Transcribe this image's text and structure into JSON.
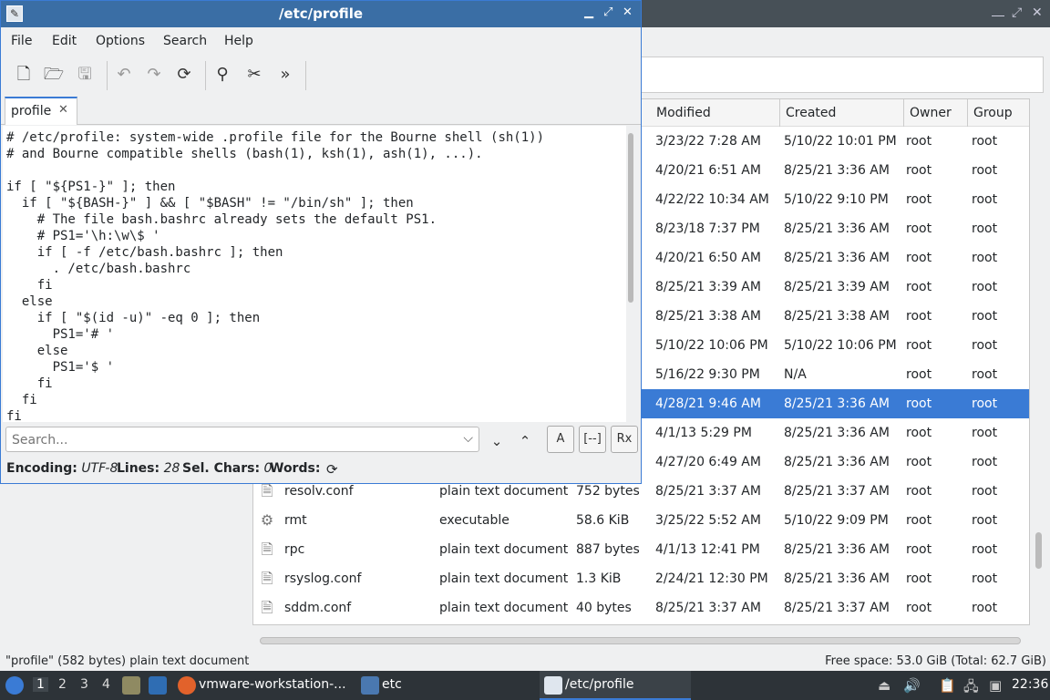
{
  "editor": {
    "title": "/etc/profile",
    "menu": [
      "File",
      "Edit",
      "Options",
      "Search",
      "Help"
    ],
    "tab_label": "profile",
    "code": "# /etc/profile: system-wide .profile file for the Bourne shell (sh(1))\n# and Bourne compatible shells (bash(1), ksh(1), ash(1), ...).\n\nif [ \"${PS1-}\" ]; then\n  if [ \"${BASH-}\" ] && [ \"$BASH\" != \"/bin/sh\" ]; then\n    # The file bash.bashrc already sets the default PS1.\n    # PS1='\\h:\\w\\$ '\n    if [ -f /etc/bash.bashrc ]; then\n      . /etc/bash.bashrc\n    fi\n  else\n    if [ \"$(id -u)\" -eq 0 ]; then\n      PS1='# '\n    else\n      PS1='$ '\n    fi\n  fi\nfi",
    "search_placeholder": "Search...",
    "search_case_label": "A",
    "search_whole_label": "[--]",
    "search_regex_label": "Rx",
    "status": {
      "encoding_label": "Encoding:",
      "encoding_value": "UTF-8",
      "lines_label": "Lines:",
      "lines_value": "28",
      "sel_label": "Sel. Chars:",
      "sel_value": "0",
      "words_label": "Words:"
    }
  },
  "file_manager": {
    "columns": [
      "Modified",
      "Created",
      "Owner",
      "Group"
    ],
    "rows": [
      {
        "name": "",
        "type": "",
        "size": "",
        "modified": "3/23/22 7:28 AM",
        "created": "5/10/22 10:01 PM",
        "owner": "root",
        "group": "root"
      },
      {
        "name": "",
        "type": "",
        "size": "",
        "modified": "4/20/21 6:51 AM",
        "created": "8/25/21 3:36 AM",
        "owner": "root",
        "group": "root"
      },
      {
        "name": "",
        "type": "",
        "size": "",
        "modified": "4/22/22 10:34 AM",
        "created": "5/10/22 9:10 PM",
        "owner": "root",
        "group": "root"
      },
      {
        "name": "",
        "type": "",
        "size": "",
        "modified": "8/23/18 7:37 PM",
        "created": "8/25/21 3:36 AM",
        "owner": "root",
        "group": "root"
      },
      {
        "name": "",
        "type": "",
        "size": "",
        "modified": "4/20/21 6:50 AM",
        "created": "8/25/21 3:36 AM",
        "owner": "root",
        "group": "root"
      },
      {
        "name": "",
        "type": "",
        "size": "",
        "modified": "8/25/21 3:39 AM",
        "created": "8/25/21 3:39 AM",
        "owner": "root",
        "group": "root"
      },
      {
        "name": "",
        "type": "",
        "size": "",
        "modified": "8/25/21 3:38 AM",
        "created": "8/25/21 3:38 AM",
        "owner": "root",
        "group": "root"
      },
      {
        "name": "",
        "type": "",
        "size": "",
        "modified": "5/10/22 10:06 PM",
        "created": "5/10/22 10:06 PM",
        "owner": "root",
        "group": "root"
      },
      {
        "name": "",
        "type": "",
        "size": "",
        "modified": "5/16/22 9:30 PM",
        "created": "N/A",
        "owner": "root",
        "group": "root"
      },
      {
        "name": "",
        "type": "",
        "size": "",
        "modified": "4/28/21 9:46 AM",
        "created": "8/25/21 3:36 AM",
        "owner": "root",
        "group": "root"
      },
      {
        "name": "",
        "type": "",
        "size": "",
        "modified": "4/1/13 5:29 PM",
        "created": "8/25/21 3:36 AM",
        "owner": "root",
        "group": "root"
      },
      {
        "name": "",
        "type": "",
        "size": "",
        "modified": "4/27/20 6:49 AM",
        "created": "8/25/21 3:36 AM",
        "owner": "root",
        "group": "root"
      },
      {
        "name": "resolv.conf",
        "type": "plain text document",
        "size": "752 bytes",
        "modified": "8/25/21 3:37 AM",
        "created": "8/25/21 3:37 AM",
        "owner": "root",
        "group": "root"
      },
      {
        "name": "rmt",
        "type": "executable",
        "size": "58.6 KiB",
        "modified": "3/25/22 5:52 AM",
        "created": "5/10/22 9:09 PM",
        "owner": "root",
        "group": "root"
      },
      {
        "name": "rpc",
        "type": "plain text document",
        "size": "887 bytes",
        "modified": "4/1/13 12:41 PM",
        "created": "8/25/21 3:36 AM",
        "owner": "root",
        "group": "root"
      },
      {
        "name": "rsyslog.conf",
        "type": "plain text document",
        "size": "1.3 KiB",
        "modified": "2/24/21 12:30 PM",
        "created": "8/25/21 3:36 AM",
        "owner": "root",
        "group": "root"
      },
      {
        "name": "sddm.conf",
        "type": "plain text document",
        "size": "40 bytes",
        "modified": "8/25/21 3:37 AM",
        "created": "8/25/21 3:37 AM",
        "owner": "root",
        "group": "root"
      }
    ],
    "selected_index": 9,
    "status_left": "\"profile\" (582 bytes) plain text document",
    "status_right": "Free space: 53.0 GiB (Total: 62.7 GiB)"
  },
  "taskbar": {
    "workspaces": [
      "1",
      "2",
      "3",
      "4"
    ],
    "tasks": [
      {
        "label": "vmware-workstation-..."
      },
      {
        "label": "etc"
      },
      {
        "label": "/etc/profile"
      }
    ],
    "clock": "22:36"
  },
  "colors": {
    "selection": "#3a7bd5",
    "titlebar": "#3a6ea5",
    "taskbar": "#2d3338"
  }
}
